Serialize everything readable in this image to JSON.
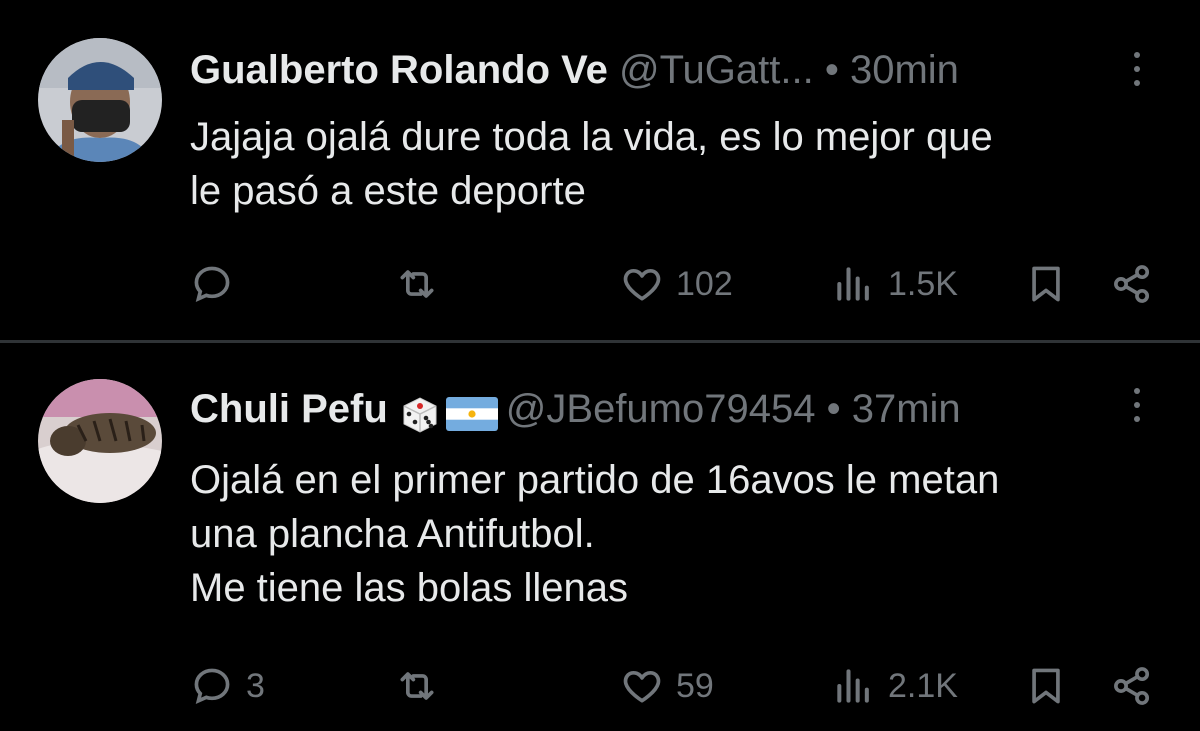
{
  "tweets": [
    {
      "display_name": "Gualberto Rolando Ve",
      "handle": "@TuGatt...",
      "separator": "•",
      "time": "30min",
      "text_lines": [
        "Jajaja ojalá dure toda la vida, es lo mejor que",
        "le pasó a este deporte"
      ],
      "replies": "",
      "reposts": "",
      "likes": "102",
      "views": "1.5K"
    },
    {
      "display_name": "Chuli Pefu",
      "handle": "@JBefumo79454",
      "separator": "•",
      "time": "37min",
      "text_lines": [
        "Ojalá en el primer partido de 16avos le metan",
        "una plancha Antifutbol.",
        "Me tiene las bolas llenas"
      ],
      "replies": "3",
      "reposts": "",
      "likes": "59",
      "views": "2.1K"
    }
  ],
  "icons": {
    "reply": "reply-icon",
    "repost": "repost-icon",
    "like": "heart-icon",
    "views": "views-icon",
    "bookmark": "bookmark-icon",
    "share": "share-icon",
    "more": "more-options-icon",
    "badges": [
      "dice-emoji",
      "argentina-flag-emoji"
    ]
  },
  "colors": {
    "background": "#000000",
    "primary_text": "#e7e9ea",
    "secondary_text": "#71767b",
    "divider": "#2f3336"
  }
}
